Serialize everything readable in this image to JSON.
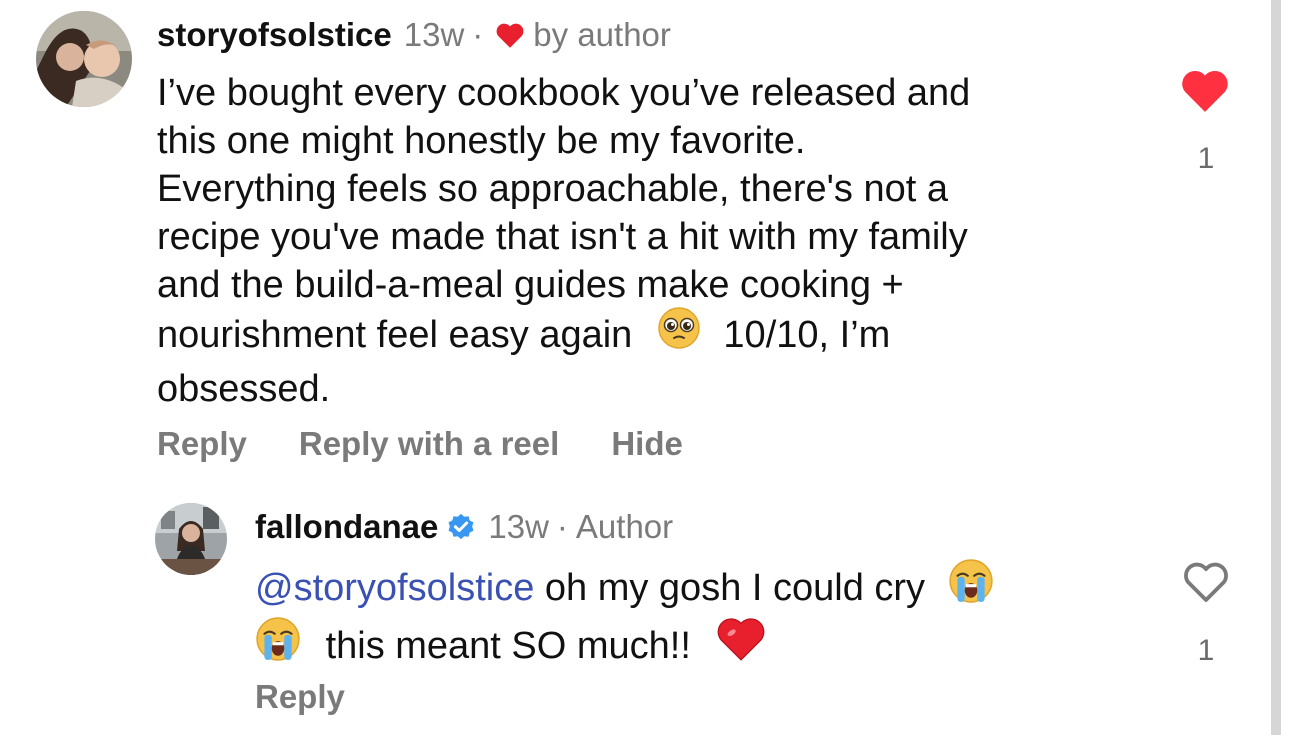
{
  "comment": {
    "username": "storyofsolstice",
    "time": "13w",
    "separator": "·",
    "liked_by": "by author",
    "lines": [
      "I’ve bought every cookbook you’ve released and",
      "this one might honestly be my favorite.",
      "Everything feels so approachable, there's not a",
      "recipe you've made that isn't a hit with my family",
      "and the build-a-meal guides make cooking +"
    ],
    "line6_before": "nourishment feel easy again",
    "line6_after": "10/10, I’m",
    "line7": "obsessed.",
    "actions": {
      "reply": "Reply",
      "reply_reel": "Reply with a reel",
      "hide": "Hide"
    },
    "like_count": "1",
    "liked": true,
    "emoji": "pleading-face"
  },
  "reply": {
    "username": "fallondanae",
    "verified": true,
    "time": "13w",
    "separator": "·",
    "role": "Author",
    "mention": "@storyofsolstice",
    "line1": "oh my gosh I could cry",
    "line2": "this meant SO much!!",
    "actions": {
      "reply": "Reply"
    },
    "like_count": "1",
    "liked": false,
    "emojis": [
      "loudly-crying-face",
      "loudly-crying-face",
      "red-heart"
    ]
  },
  "colors": {
    "like_red": "#ff3040",
    "heart_emoji_red": "#e8202e",
    "secondary_text": "#7a7a7a",
    "mention_blue": "#3a51b3",
    "verified_blue": "#3897f0"
  }
}
